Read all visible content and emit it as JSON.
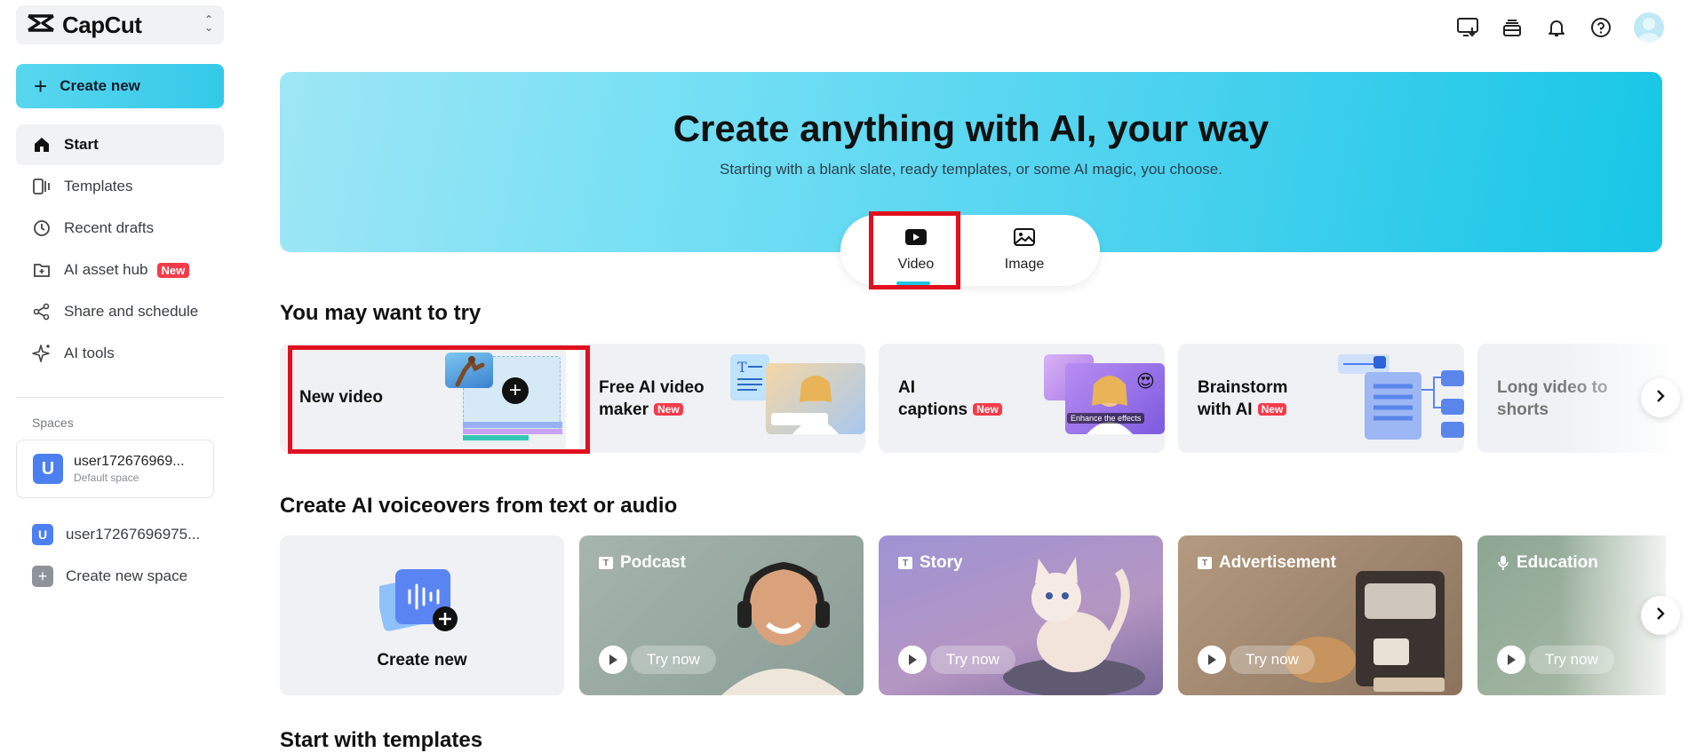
{
  "app": {
    "name": "CapCut"
  },
  "sidebar": {
    "create_new": "Create new",
    "items": [
      {
        "label": "Start",
        "icon": "home-icon"
      },
      {
        "label": "Templates",
        "icon": "templates-icon"
      },
      {
        "label": "Recent drafts",
        "icon": "clock-icon"
      },
      {
        "label": "AI asset hub",
        "icon": "asset-hub-icon",
        "badge": "New"
      },
      {
        "label": "Share and schedule",
        "icon": "share-icon"
      },
      {
        "label": "AI tools",
        "icon": "sparkle-icon"
      }
    ],
    "spaces_label": "Spaces",
    "space_card": {
      "initial": "U",
      "name": "user172676969...",
      "sub": "Default space"
    },
    "space_row": {
      "initial": "U",
      "name": "user17267696975..."
    },
    "create_space": "Create new space"
  },
  "hero": {
    "title": "Create anything with AI, your way",
    "subtitle": "Starting with a blank slate, ready templates, or some AI magic, you choose.",
    "modes": [
      "Video",
      "Image"
    ],
    "active_mode": "Video"
  },
  "try_section": {
    "title": "You may want to try",
    "cards": [
      {
        "label": "New video"
      },
      {
        "label_line1": "Free AI video",
        "label_line2": "maker",
        "badge": "New"
      },
      {
        "label_line1": "AI",
        "label_line2": "captions",
        "badge": "New",
        "overlay": "Enhance the effects"
      },
      {
        "label_line1": "Brainstorm",
        "label_line2": "with AI",
        "badge": "New"
      },
      {
        "label_line1": "Long video to",
        "label_line2": "shorts"
      }
    ]
  },
  "voiceover_section": {
    "title": "Create AI voiceovers from text or audio",
    "create_new": "Create new",
    "try_now": "Try now",
    "cards": [
      {
        "label": "Podcast",
        "color": "#9aa9a2"
      },
      {
        "label": "Story",
        "color": "#9b8fcf"
      },
      {
        "label": "Advertisement",
        "color": "#a38a72"
      },
      {
        "label": "Education",
        "color": "#8faa94"
      }
    ]
  },
  "templates_section": {
    "title": "Start with templates"
  },
  "colors": {
    "accent": "#1dc5e3",
    "highlight": "#e0101f",
    "badge": "#f53b4a"
  }
}
